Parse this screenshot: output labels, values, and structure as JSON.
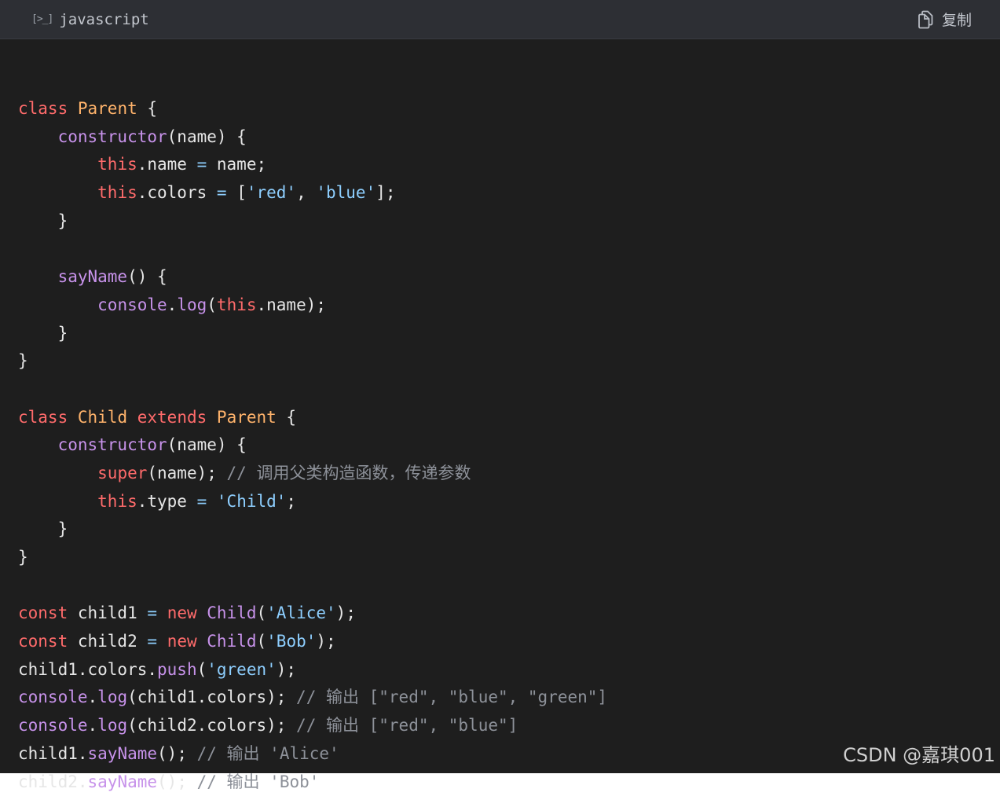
{
  "toolbar": {
    "lang_icon": "[>_]",
    "language": "javascript",
    "copy_label": "复制",
    "copy_icon": "copy-icon"
  },
  "code_lines": [
    [
      [
        "k",
        "class"
      ],
      [
        "p",
        " "
      ],
      [
        "c",
        "Parent"
      ],
      [
        "p",
        " {"
      ]
    ],
    [
      [
        "p",
        "    "
      ],
      [
        "f",
        "constructor"
      ],
      [
        "p",
        "(name) {"
      ]
    ],
    [
      [
        "p",
        "        "
      ],
      [
        "k",
        "this"
      ],
      [
        "p",
        ".name "
      ],
      [
        "o",
        "="
      ],
      [
        "p",
        " name;"
      ]
    ],
    [
      [
        "p",
        "        "
      ],
      [
        "k",
        "this"
      ],
      [
        "p",
        ".colors "
      ],
      [
        "o",
        "="
      ],
      [
        "p",
        " ["
      ],
      [
        "s",
        "'red'"
      ],
      [
        "p",
        ", "
      ],
      [
        "s",
        "'blue'"
      ],
      [
        "p",
        "];"
      ]
    ],
    [
      [
        "p",
        "    }"
      ]
    ],
    [],
    [
      [
        "p",
        "    "
      ],
      [
        "f",
        "sayName"
      ],
      [
        "p",
        "() {"
      ]
    ],
    [
      [
        "p",
        "        "
      ],
      [
        "f",
        "console"
      ],
      [
        "p",
        "."
      ],
      [
        "f",
        "log"
      ],
      [
        "p",
        "("
      ],
      [
        "k",
        "this"
      ],
      [
        "p",
        ".name);"
      ]
    ],
    [
      [
        "p",
        "    }"
      ]
    ],
    [
      [
        "p",
        "}"
      ]
    ],
    [],
    [
      [
        "k",
        "class"
      ],
      [
        "p",
        " "
      ],
      [
        "c",
        "Child"
      ],
      [
        "p",
        " "
      ],
      [
        "k",
        "extends"
      ],
      [
        "p",
        " "
      ],
      [
        "c",
        "Parent"
      ],
      [
        "p",
        " {"
      ]
    ],
    [
      [
        "p",
        "    "
      ],
      [
        "f",
        "constructor"
      ],
      [
        "p",
        "(name) {"
      ]
    ],
    [
      [
        "p",
        "        "
      ],
      [
        "k",
        "super"
      ],
      [
        "p",
        "(name); "
      ],
      [
        "m",
        "// 调用父类构造函数，传递参数"
      ]
    ],
    [
      [
        "p",
        "        "
      ],
      [
        "k",
        "this"
      ],
      [
        "p",
        ".type "
      ],
      [
        "o",
        "="
      ],
      [
        "p",
        " "
      ],
      [
        "s",
        "'Child'"
      ],
      [
        "p",
        ";"
      ]
    ],
    [
      [
        "p",
        "    }"
      ]
    ],
    [
      [
        "p",
        "}"
      ]
    ],
    [],
    [
      [
        "k",
        "const"
      ],
      [
        "p",
        " child1 "
      ],
      [
        "o",
        "="
      ],
      [
        "p",
        " "
      ],
      [
        "k",
        "new"
      ],
      [
        "p",
        " "
      ],
      [
        "f",
        "Child"
      ],
      [
        "p",
        "("
      ],
      [
        "s",
        "'Alice'"
      ],
      [
        "p",
        ");"
      ]
    ],
    [
      [
        "k",
        "const"
      ],
      [
        "p",
        " child2 "
      ],
      [
        "o",
        "="
      ],
      [
        "p",
        " "
      ],
      [
        "k",
        "new"
      ],
      [
        "p",
        " "
      ],
      [
        "f",
        "Child"
      ],
      [
        "p",
        "("
      ],
      [
        "s",
        "'Bob'"
      ],
      [
        "p",
        ");"
      ]
    ],
    [
      [
        "p",
        "child1.colors."
      ],
      [
        "f",
        "push"
      ],
      [
        "p",
        "("
      ],
      [
        "s",
        "'green'"
      ],
      [
        "p",
        ");"
      ]
    ],
    [
      [
        "f",
        "console"
      ],
      [
        "p",
        "."
      ],
      [
        "f",
        "log"
      ],
      [
        "p",
        "(child1.colors); "
      ],
      [
        "m",
        "// 输出 [\"red\", \"blue\", \"green\"]"
      ]
    ],
    [
      [
        "f",
        "console"
      ],
      [
        "p",
        "."
      ],
      [
        "f",
        "log"
      ],
      [
        "p",
        "(child2.colors); "
      ],
      [
        "m",
        "// 输出 [\"red\", \"blue\"]"
      ]
    ],
    [
      [
        "p",
        "child1."
      ],
      [
        "f",
        "sayName"
      ],
      [
        "p",
        "(); "
      ],
      [
        "m",
        "// 输出 'Alice'"
      ]
    ],
    [
      [
        "p",
        "child2."
      ],
      [
        "f",
        "sayName"
      ],
      [
        "p",
        "(); "
      ],
      [
        "m",
        "// 输出 'Bob'"
      ]
    ]
  ],
  "watermark": "CSDN @嘉琪001",
  "colors": {
    "background": "#1e1e1e",
    "toolbar": "#2d2f34",
    "keyword": "#ff6b6b",
    "class_name": "#ffb36b",
    "function": "#c792ea",
    "string": "#8ecfff",
    "comment": "#8d9199"
  }
}
